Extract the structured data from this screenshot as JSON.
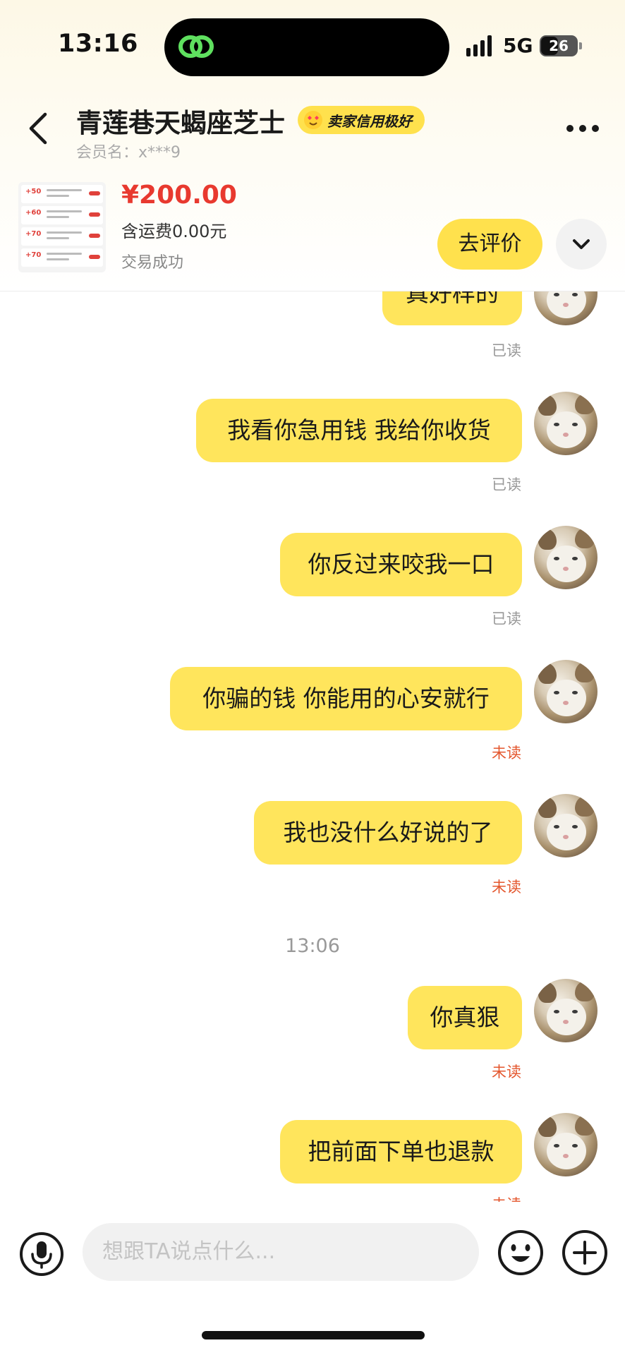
{
  "status_bar": {
    "time": "13:16",
    "network": "5G",
    "battery": "26"
  },
  "header": {
    "title": "青莲巷天蝎座芝士",
    "credit_badge": "卖家信用极好",
    "member_name": "会员名：x***9"
  },
  "order": {
    "thumb_prices": [
      "+50",
      "+60",
      "+70",
      "+70"
    ],
    "price": "¥200.00",
    "shipping": "含运费0.00元",
    "status": "交易成功",
    "review_button": "去评价"
  },
  "messages": [
    {
      "text": "真好样的",
      "receipt": "已读"
    },
    {
      "text": "我看你急用钱 我给你收货",
      "receipt": "已读"
    },
    {
      "text": "你反过来咬我一口",
      "receipt": "已读"
    },
    {
      "text": "你骗的钱 你能用的心安就行",
      "receipt": "未读"
    },
    {
      "text": "我也没什么好说的了",
      "receipt": "未读"
    },
    {
      "text": "你真狠",
      "receipt": "未读"
    },
    {
      "text": "把前面下单也退款",
      "receipt": "未读"
    }
  ],
  "time_separator": "13:06",
  "input": {
    "placeholder": "想跟TA说点什么..."
  },
  "colors": {
    "accent_yellow": "#ffe14d",
    "bubble_yellow": "#ffe55c",
    "price_red": "#e8392f",
    "unread_orange": "#e4572e"
  }
}
